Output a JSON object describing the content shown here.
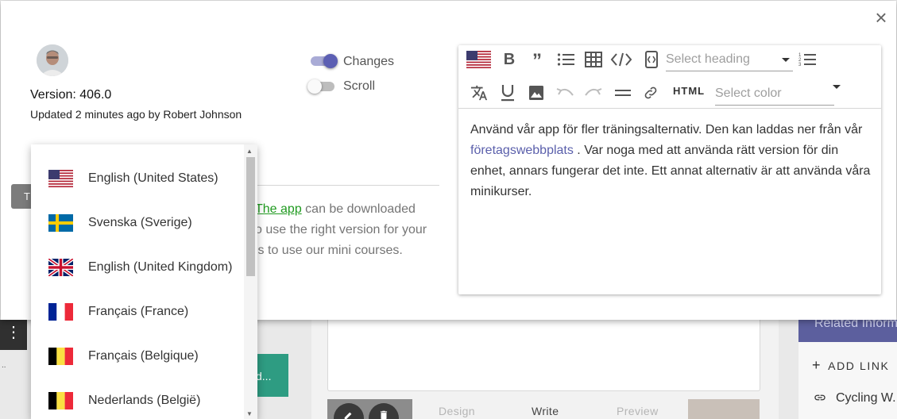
{
  "background": {
    "dark_strip_icon": "⋮",
    "small_dots": "..",
    "teal_button_label": "d...",
    "tabs": [
      "Design",
      "Write",
      "Preview"
    ],
    "thumb_edit_icon": "pencil-icon",
    "thumb_delete_icon": "trash-icon",
    "related_header": "Related Information",
    "add_link_label": "ADD LINK",
    "add_link_icon": "+",
    "cycling_link": "Cycling W..."
  },
  "dialog": {
    "close_icon": "×",
    "version": "Version: 406.0",
    "updated": "Updated 2 minutes ago by Robert Johnson",
    "toggles": [
      {
        "label": "Changes",
        "on": true
      },
      {
        "label": "Scroll",
        "on": false
      }
    ],
    "grey_tag_letter": "T",
    "original_text": {
      "link": "The app",
      "line1_suffix": " can be downloaded",
      "line2": "o use the right version for your",
      "line3": "is to use our mini courses."
    }
  },
  "language_dropdown": {
    "options": [
      {
        "label": "English (United States)",
        "flag": "us"
      },
      {
        "label": "Svenska (Sverige)",
        "flag": "se"
      },
      {
        "label": "English (United Kingdom)",
        "flag": "gb"
      },
      {
        "label": "Français (France)",
        "flag": "fr"
      },
      {
        "label": "Français (Belgique)",
        "flag": "be"
      },
      {
        "label": "Nederlands (België)",
        "flag": "be"
      }
    ]
  },
  "editor": {
    "heading_placeholder": "Select heading",
    "color_placeholder": "Select color",
    "html_label": "HTML",
    "bold_label": "B",
    "quote_label": "”",
    "body": {
      "part1": "Använd vår app för fler träningsalternativ. Den kan laddas ner från vår ",
      "link": "företagswebbplats",
      "part2": " . Var noga med att använda rätt version för din enhet, annars fungerar det inte. Ett annat alternativ är att använda våra minikurser."
    }
  },
  "colors": {
    "accent": "#5c5fb3",
    "link_green": "#1f9a1f",
    "link_purple": "#5a5fab",
    "teal": "#2e9c82"
  }
}
